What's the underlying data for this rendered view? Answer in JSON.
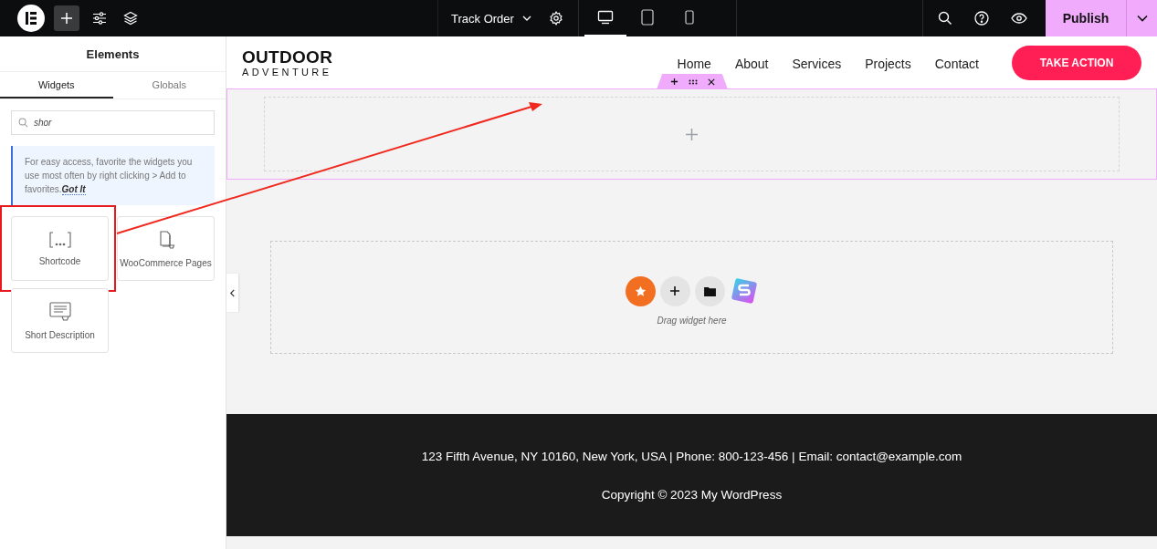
{
  "topbar": {
    "page_title": "Track Order",
    "devices": [
      {
        "kind": "desktop",
        "selected": true
      },
      {
        "kind": "tablet",
        "selected": false
      },
      {
        "kind": "mobile",
        "selected": false
      }
    ],
    "publish": "Publish"
  },
  "panel": {
    "title": "Elements",
    "tabs": [
      {
        "label": "Widgets",
        "selected": true
      },
      {
        "label": "Globals",
        "selected": false
      }
    ],
    "search": {
      "value": "shor"
    },
    "tip": {
      "text": "For easy access, favorite the widgets you use most often by right clicking > Add to favorites.",
      "link": "Got It"
    },
    "widgets": [
      {
        "label": "Shortcode",
        "kind": "shortcode",
        "highlighted": true
      },
      {
        "label": "WooCommerce Pages",
        "kind": "pages",
        "highlighted": false
      },
      {
        "label": "Short Description",
        "kind": "description",
        "highlighted": false
      }
    ]
  },
  "site": {
    "logo": {
      "line_1": "OUTDOOR",
      "line_2": "ADVENTURE"
    },
    "nav": [
      "Home",
      "About",
      "Services",
      "Projects",
      "Contact"
    ],
    "cta": "TAKE ACTION",
    "drop_hint": "Drag widget here",
    "footer": [
      "123 Fifth Avenue, NY 10160, New York, USA | Phone: 800-123-456 | Email: contact@example.com",
      "Copyright © 2023 My WordPress"
    ]
  }
}
